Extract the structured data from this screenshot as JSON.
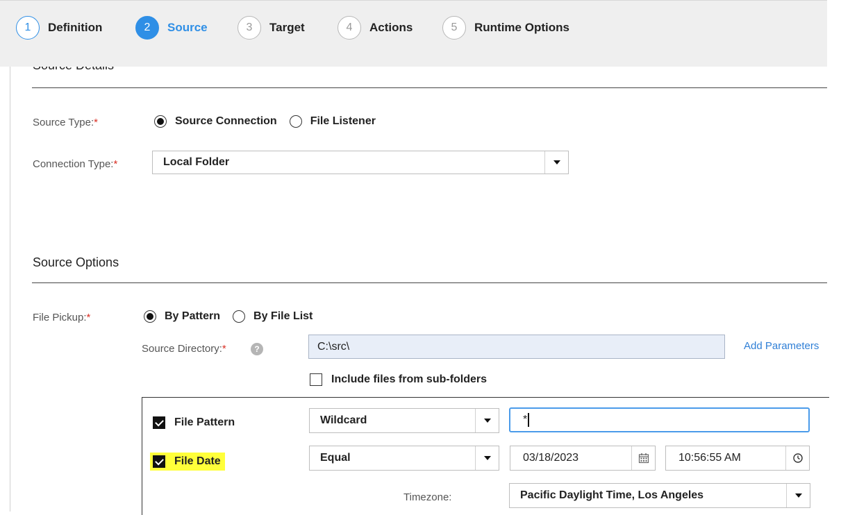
{
  "wizard": {
    "steps": [
      {
        "num": "1",
        "label": "Definition",
        "state": "done"
      },
      {
        "num": "2",
        "label": "Source",
        "state": "active"
      },
      {
        "num": "3",
        "label": "Target",
        "state": "todo"
      },
      {
        "num": "4",
        "label": "Actions",
        "state": "todo"
      },
      {
        "num": "5",
        "label": "Runtime Options",
        "state": "todo"
      }
    ]
  },
  "source_details": {
    "heading": "Source Details",
    "source_type_label": "Source Type:",
    "source_type_options": [
      "Source Connection",
      "File Listener"
    ],
    "source_type_selected": "Source Connection",
    "connection_type_label": "Connection Type:",
    "connection_type_value": "Local Folder"
  },
  "source_options": {
    "heading": "Source Options",
    "file_pickup_label": "File Pickup:",
    "file_pickup_options": [
      "By Pattern",
      "By File List"
    ],
    "file_pickup_selected": "By Pattern",
    "source_directory_label": "Source Directory:",
    "source_directory_value": "C:\\src\\",
    "add_parameters_link": "Add Parameters",
    "include_subfolders_label": "Include files from sub-folders",
    "include_subfolders_checked": false,
    "file_pattern": {
      "label": "File Pattern",
      "checked": true,
      "type_value": "Wildcard",
      "pattern_value": "*"
    },
    "file_date": {
      "label": "File Date",
      "checked": true,
      "operator_value": "Equal",
      "date_value": "03/18/2023",
      "time_value": "10:56:55 AM",
      "highlight_color": "#ffff3a"
    },
    "timezone_label": "Timezone:",
    "timezone_value": "Pacific Daylight Time, Los Angeles"
  },
  "colors": {
    "accent": "#2f8fe6",
    "required": "#d93025",
    "link": "#2f7fd6"
  },
  "icons": [
    "help-icon",
    "calendar-icon",
    "clock-icon",
    "dropdown-arrow-icon",
    "checkmark-icon"
  ]
}
